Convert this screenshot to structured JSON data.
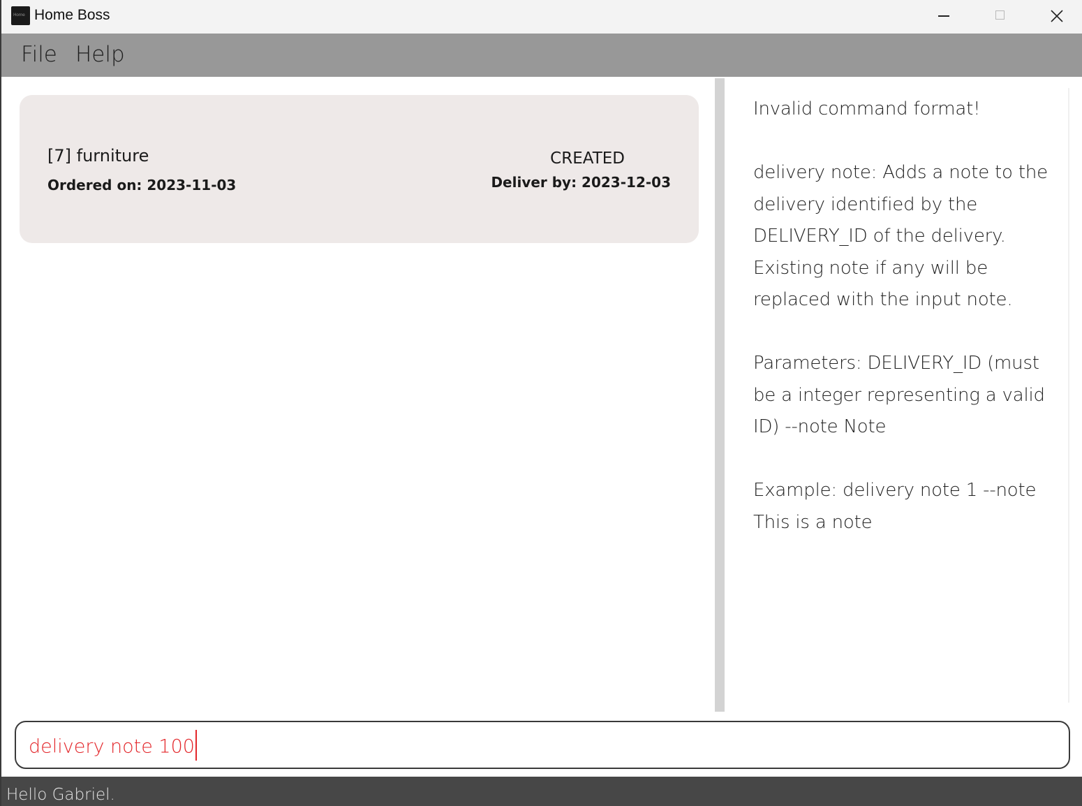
{
  "window": {
    "title": "Home Boss",
    "icon_name": "home-boss-app-icon",
    "icon_text": "Home"
  },
  "menu": {
    "items": [
      {
        "label": "File"
      },
      {
        "label": "Help"
      }
    ]
  },
  "deliveries": [
    {
      "title": "[7] furniture",
      "ordered_on": "Ordered on: 2023-11-03",
      "status": "CREATED",
      "deliver_by": "Deliver by: 2023-12-03"
    }
  ],
  "result": {
    "heading": "Invalid command format!",
    "description": "delivery note: Adds a note to the delivery identified by the DELIVERY_ID of the delivery. Existing note if any will be replaced with the input note.",
    "parameters": "Parameters: DELIVERY_ID (must be a integer representing a valid ID) --note Note",
    "example": "Example: delivery note 1 --note This is a note"
  },
  "command": {
    "value": "delivery note 100",
    "color": "#e3262a"
  },
  "status_bar": {
    "text": "Hello Gabriel."
  },
  "colors": {
    "menubar": "#989898",
    "card": "#eee9e8",
    "statusbar": "#474747",
    "error_text": "#e3262a"
  }
}
